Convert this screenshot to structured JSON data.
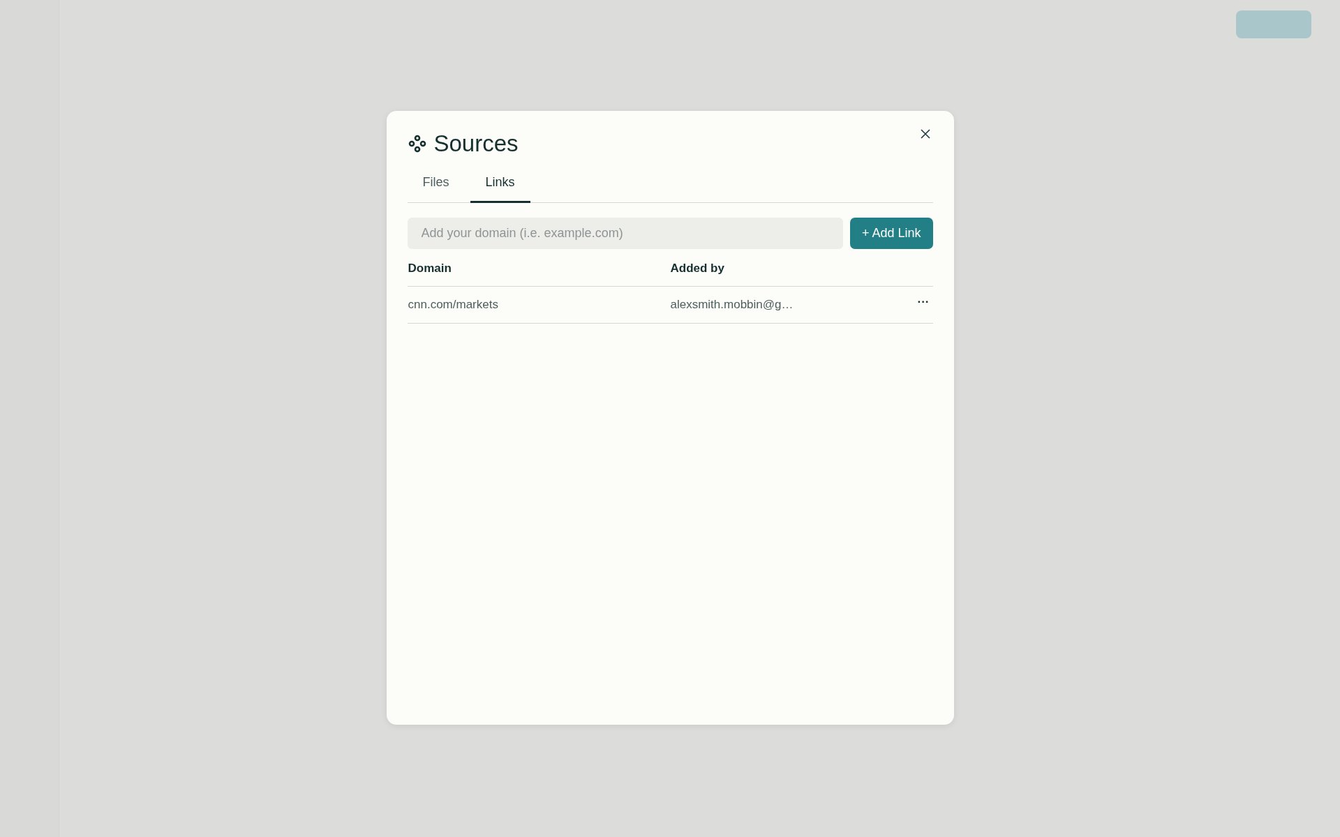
{
  "dialog": {
    "title": "Sources",
    "tabs": [
      {
        "label": "Files",
        "selected": false
      },
      {
        "label": "Links",
        "selected": true
      }
    ],
    "link_input": {
      "placeholder": "Add your domain (i.e. example.com)"
    },
    "add_button": "+ Add Link",
    "table": {
      "columns": [
        "Domain",
        "Added by"
      ],
      "rows": [
        {
          "domain": "cnn.com/markets",
          "added_by": "alexsmith.mobbin@g…",
          "actions": "···"
        }
      ]
    }
  }
}
